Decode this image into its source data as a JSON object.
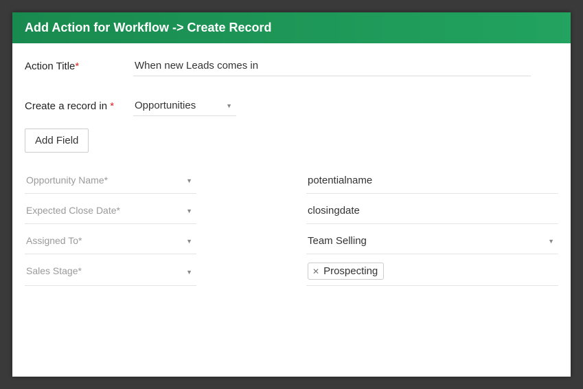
{
  "header": {
    "title": "Add Action for Workflow -> Create Record"
  },
  "action_title": {
    "label": "Action Title",
    "required": "*",
    "value": "When new Leads comes in"
  },
  "create_in": {
    "label": "Create a record in ",
    "required": "*",
    "selected": "Opportunities"
  },
  "add_field_btn": "Add Field",
  "field_rows": [
    {
      "field_label": "Opportunity Name*",
      "value_type": "text",
      "value": "potentialname"
    },
    {
      "field_label": "Expected Close Date*",
      "value_type": "text",
      "value": "closingdate"
    },
    {
      "field_label": "Assigned To*",
      "value_type": "select",
      "value": "Team Selling"
    },
    {
      "field_label": "Sales Stage*",
      "value_type": "tag",
      "value": "Prospecting"
    }
  ]
}
